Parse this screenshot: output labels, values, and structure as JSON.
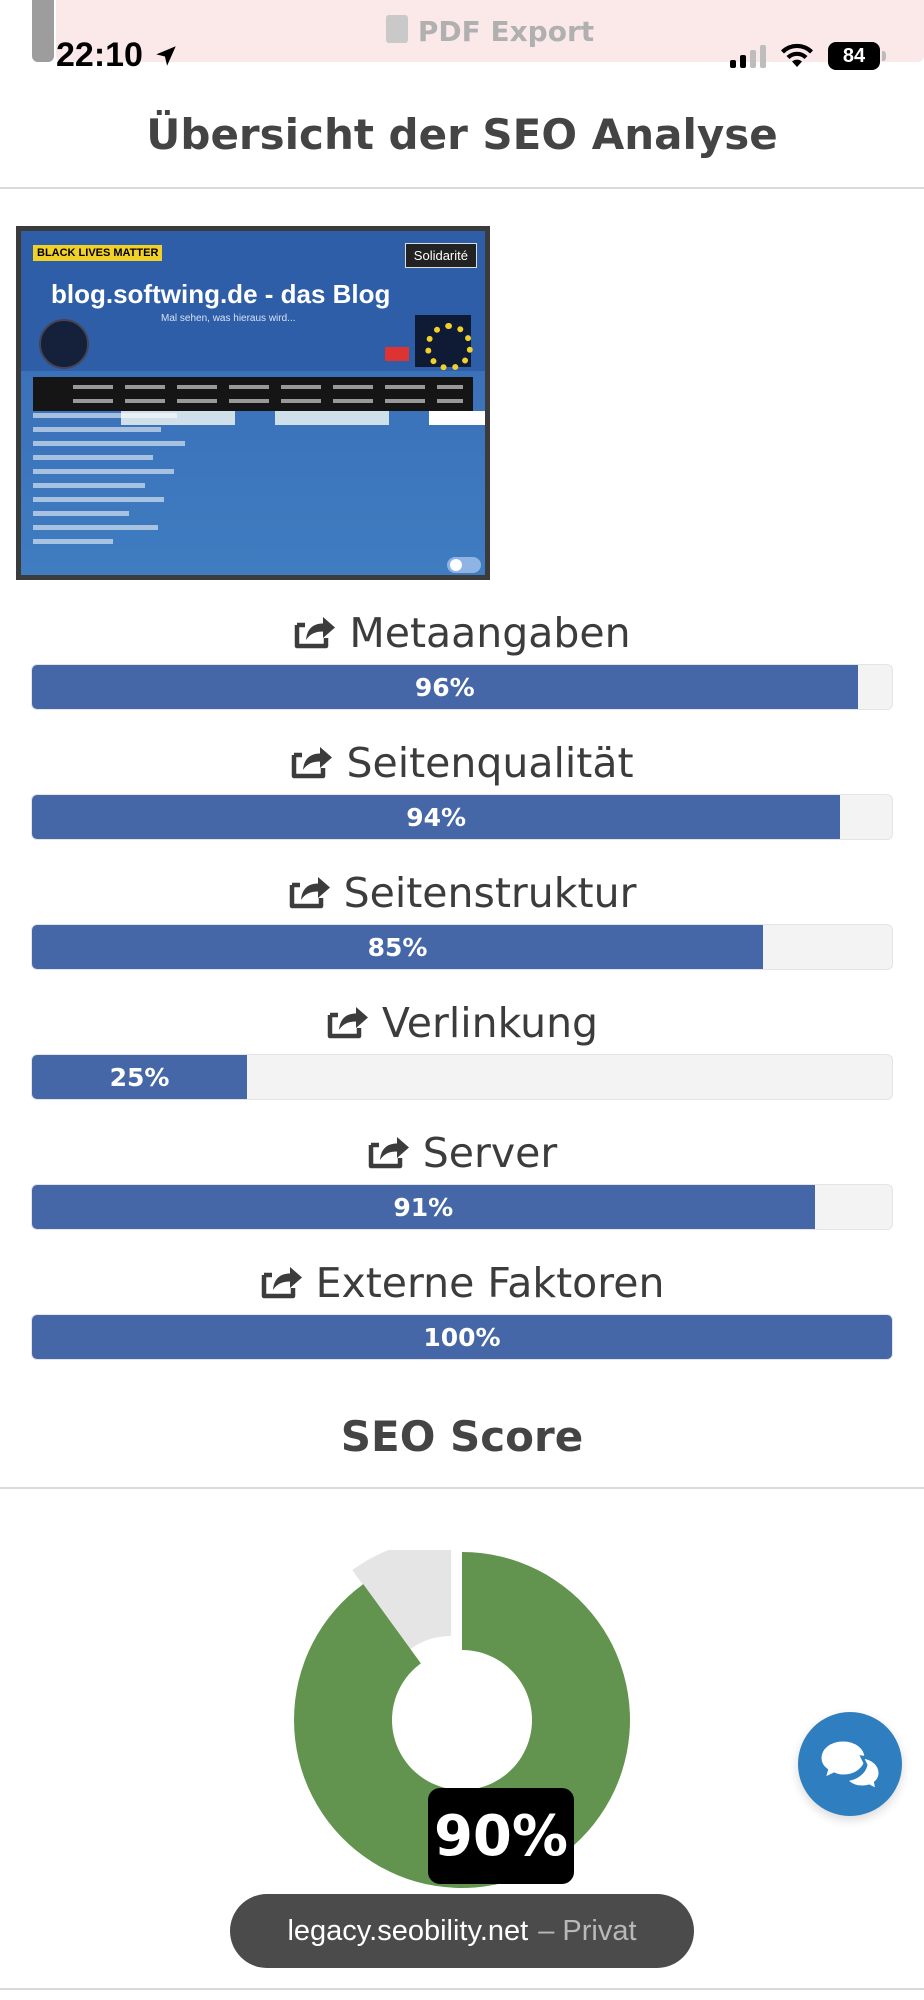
{
  "status_bar": {
    "time": "22:10",
    "battery": "84",
    "pdf_export_label": "PDF Export"
  },
  "overview": {
    "title": "Übersicht der SEO Analyse"
  },
  "thumbnail": {
    "site_title": "blog.softwing.de - das Blog",
    "tagline": "Mal sehen, was hieraus wird...",
    "tag": "BLACK LIVES MATTER",
    "badge": "Solidarité"
  },
  "categories": [
    {
      "label": "Metaangaben",
      "percent_text": "96%",
      "value": 96
    },
    {
      "label": "Seitenqualität",
      "percent_text": "94%",
      "value": 94
    },
    {
      "label": "Seitenstruktur",
      "percent_text": "85%",
      "value": 85
    },
    {
      "label": "Verlinkung",
      "percent_text": "25%",
      "value": 25
    },
    {
      "label": "Server",
      "percent_text": "91%",
      "value": 91
    },
    {
      "label": "Externe Faktoren",
      "percent_text": "100%",
      "value": 100
    }
  ],
  "score": {
    "title": "SEO Score",
    "value": 90,
    "value_text": "90%",
    "color_filled": "#62944f",
    "color_remaining": "#e5e5e5"
  },
  "browser": {
    "domain": "legacy.seobility.net",
    "mode": "– Privat"
  },
  "colors": {
    "bar_fill": "#4667a7",
    "bar_track": "#f3f3f3",
    "chat_button": "#2f7fc0"
  },
  "icons": {
    "category": "share-square-icon",
    "chat": "chat-bubbles-icon",
    "pdf": "document-icon"
  }
}
